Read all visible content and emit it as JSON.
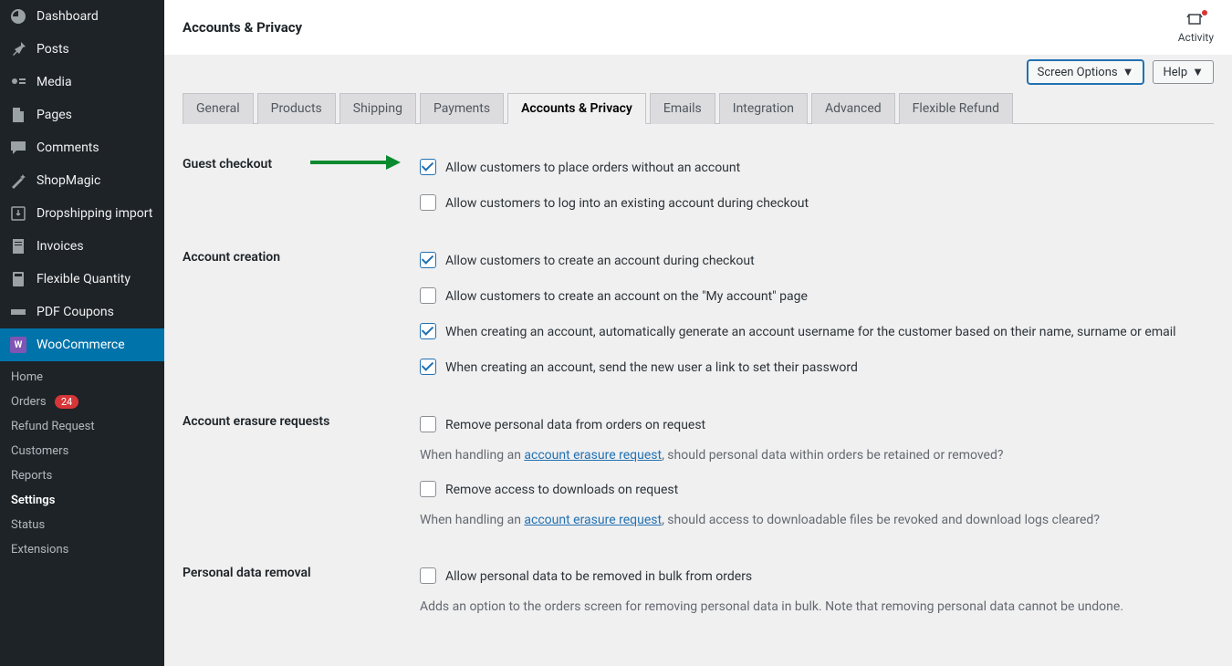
{
  "sidebar": {
    "items": [
      {
        "label": "Dashboard"
      },
      {
        "label": "Posts"
      },
      {
        "label": "Media"
      },
      {
        "label": "Pages"
      },
      {
        "label": "Comments"
      },
      {
        "label": "ShopMagic"
      },
      {
        "label": "Dropshipping import"
      },
      {
        "label": "Invoices"
      },
      {
        "label": "Flexible Quantity"
      },
      {
        "label": "PDF Coupons"
      },
      {
        "label": "WooCommerce"
      }
    ],
    "submenu": [
      {
        "label": "Home"
      },
      {
        "label": "Orders",
        "badge": "24"
      },
      {
        "label": "Refund Request"
      },
      {
        "label": "Customers"
      },
      {
        "label": "Reports"
      },
      {
        "label": "Settings"
      },
      {
        "label": "Status"
      },
      {
        "label": "Extensions"
      }
    ]
  },
  "header": {
    "title": "Accounts & Privacy",
    "activity": "Activity",
    "screen_options": "Screen Options",
    "help": "Help"
  },
  "tabs": [
    {
      "label": "General"
    },
    {
      "label": "Products"
    },
    {
      "label": "Shipping"
    },
    {
      "label": "Payments"
    },
    {
      "label": "Accounts & Privacy"
    },
    {
      "label": "Emails"
    },
    {
      "label": "Integration"
    },
    {
      "label": "Advanced"
    },
    {
      "label": "Flexible Refund"
    }
  ],
  "sections": {
    "guest_checkout": {
      "title": "Guest checkout",
      "opt1": "Allow customers to place orders without an account",
      "opt2": "Allow customers to log into an existing account during checkout"
    },
    "account_creation": {
      "title": "Account creation",
      "opt1": "Allow customers to create an account during checkout",
      "opt2": "Allow customers to create an account on the \"My account\" page",
      "opt3": "When creating an account, automatically generate an account username for the customer based on their name, surname or email",
      "opt4": "When creating an account, send the new user a link to set their password"
    },
    "erasure": {
      "title": "Account erasure requests",
      "opt1": "Remove personal data from orders on request",
      "desc1_a": "When handling an ",
      "desc1_link": "account erasure request",
      "desc1_b": ", should personal data within orders be retained or removed?",
      "opt2": "Remove access to downloads on request",
      "desc2_a": "When handling an ",
      "desc2_link": "account erasure request",
      "desc2_b": ", should access to downloadable files be revoked and download logs cleared?"
    },
    "removal": {
      "title": "Personal data removal",
      "opt1": "Allow personal data to be removed in bulk from orders",
      "desc1": "Adds an option to the orders screen for removing personal data in bulk. Note that removing personal data cannot be undone."
    }
  }
}
